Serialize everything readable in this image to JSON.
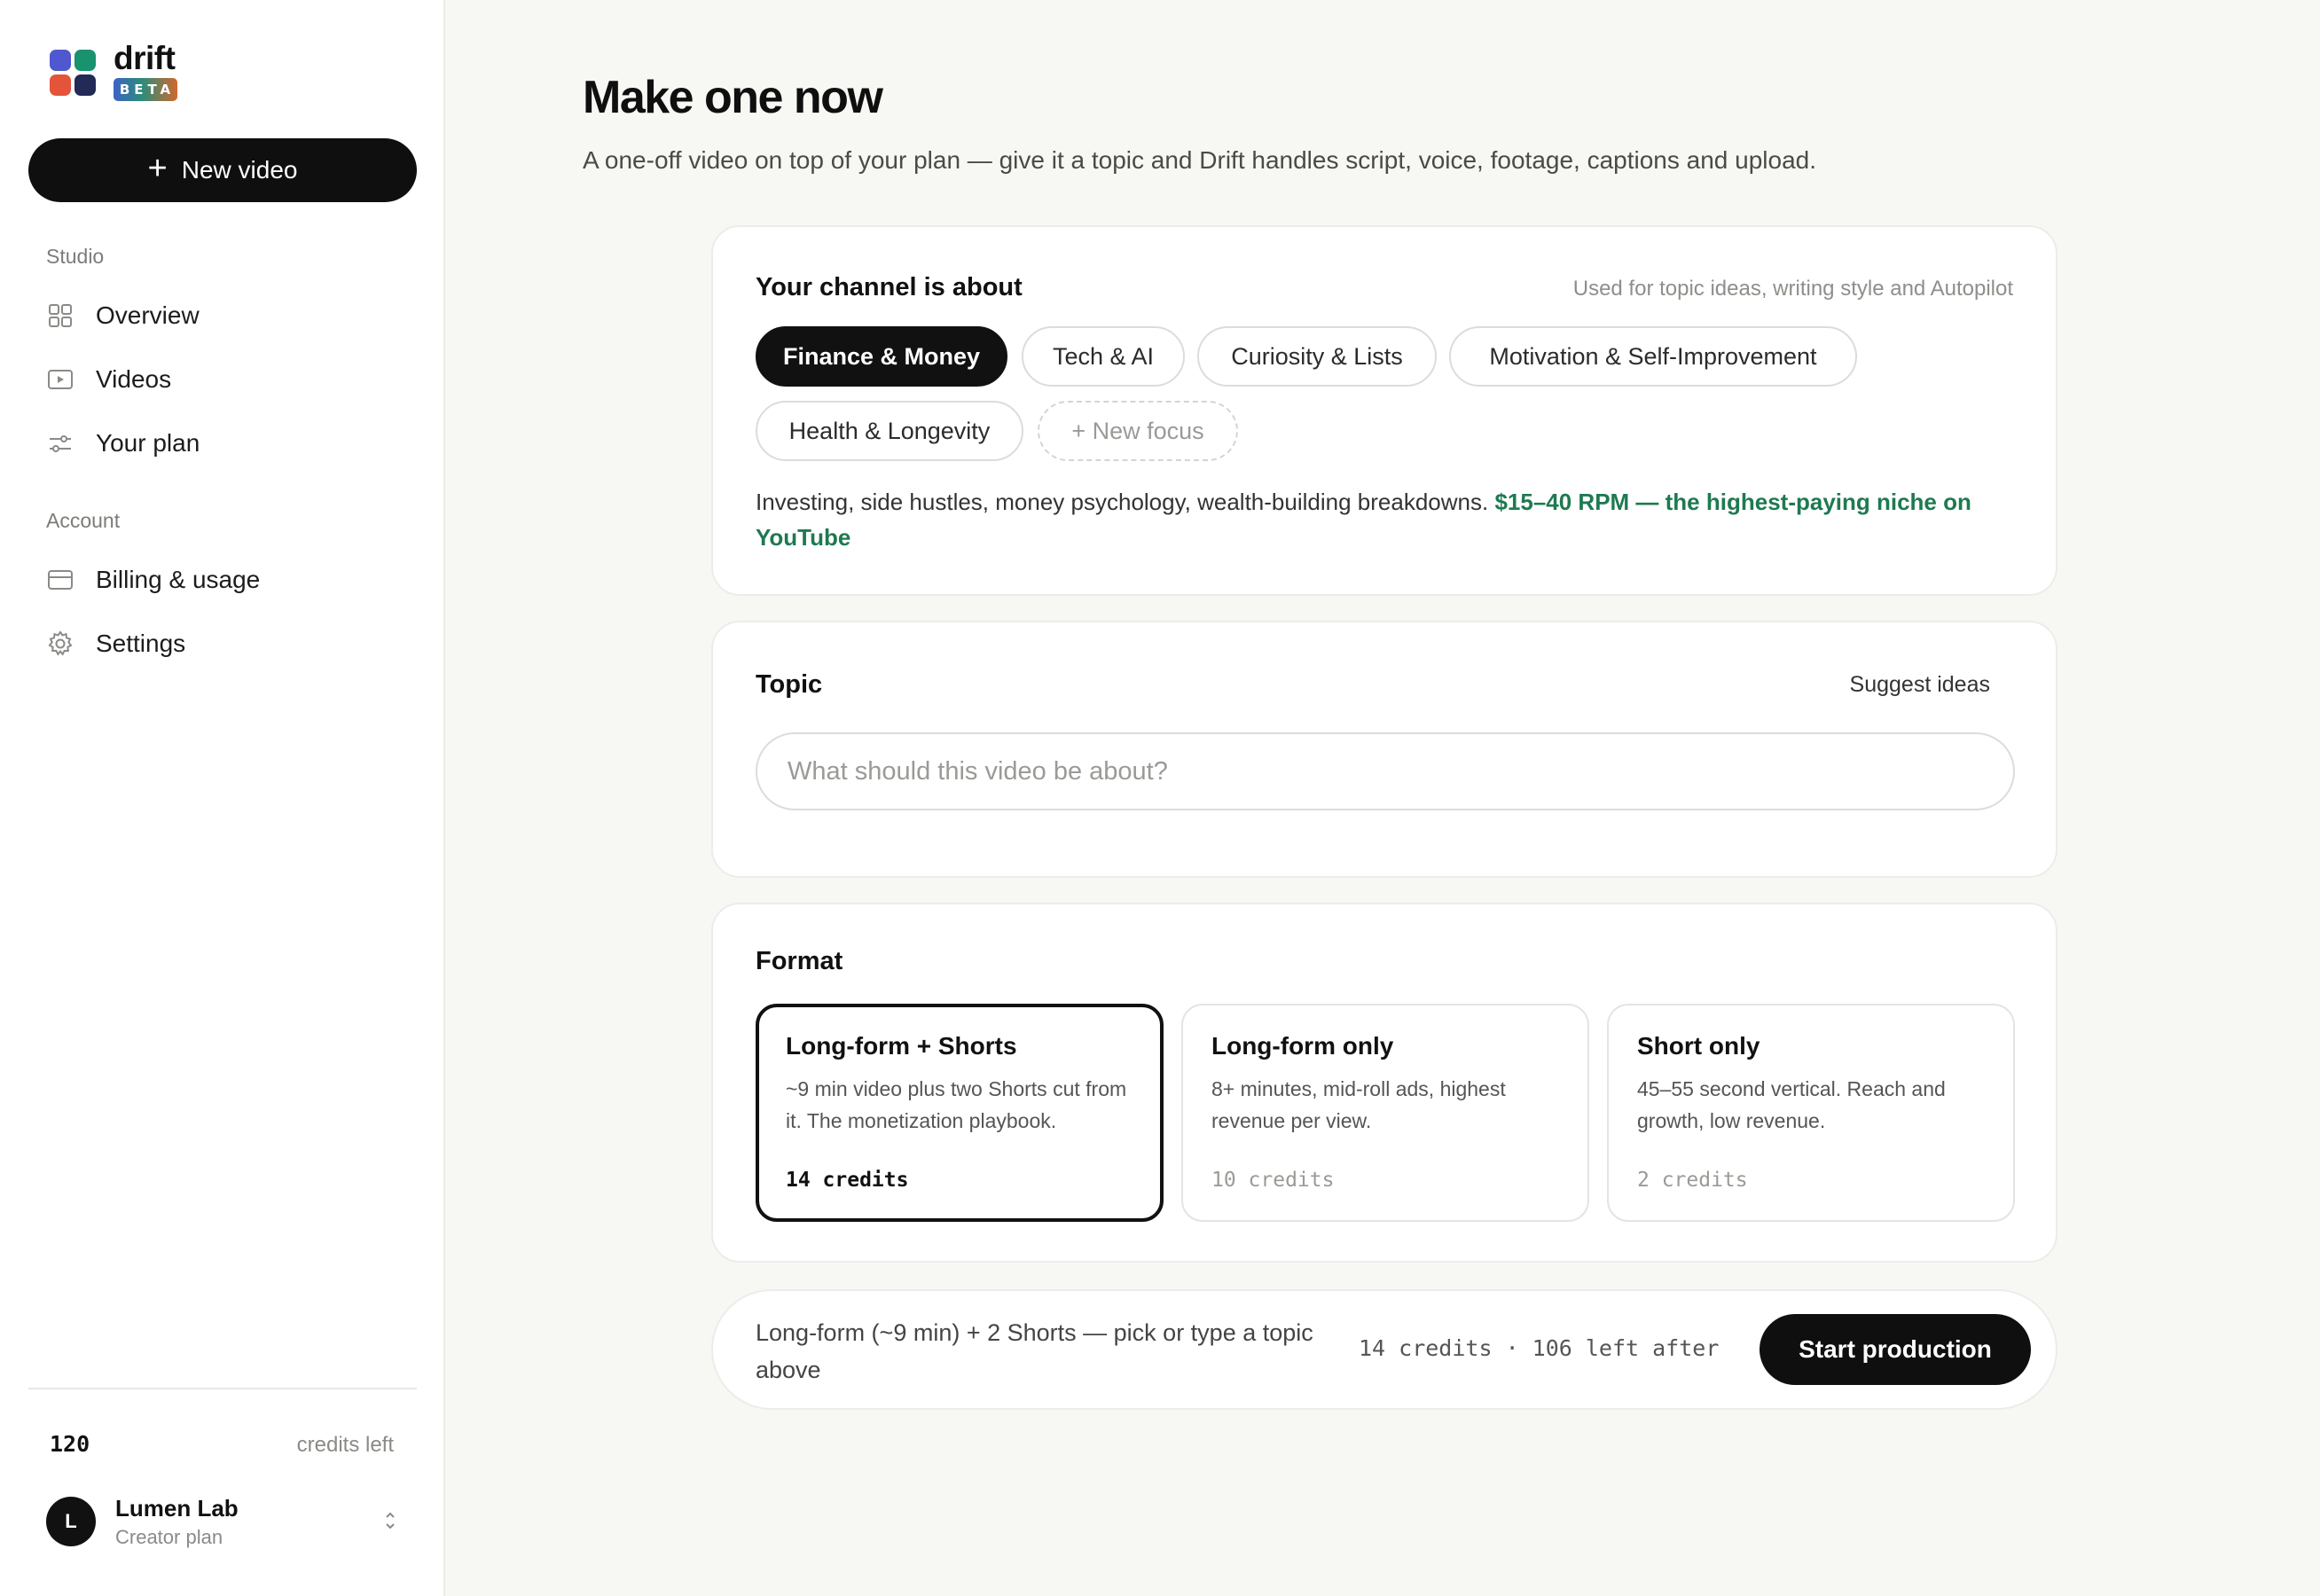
{
  "brand": {
    "name": "drift",
    "badge": "BETA",
    "logo_colors": [
      "#4f58cf",
      "#19926e",
      "#e3543a",
      "#222a55"
    ]
  },
  "sidebar": {
    "new_video_label": "New video",
    "sections": [
      {
        "title": "Studio",
        "items": [
          {
            "label": "Overview",
            "icon": "grid-icon"
          },
          {
            "label": "Videos",
            "icon": "play-icon"
          },
          {
            "label": "Your plan",
            "icon": "sliders-icon"
          }
        ]
      },
      {
        "title": "Account",
        "items": [
          {
            "label": "Billing & usage",
            "icon": "card-icon"
          },
          {
            "label": "Settings",
            "icon": "gear-icon"
          }
        ]
      }
    ],
    "credits": {
      "value": "120",
      "label": "credits left"
    },
    "account": {
      "initial": "L",
      "name": "Lumen Lab",
      "plan": "Creator plan"
    }
  },
  "main": {
    "title": "Make one now",
    "subtitle": "A one-off video on top of your plan — give it a topic and Drift handles script, voice, footage, captions and upload.",
    "channel": {
      "title": "Your channel is about",
      "hint": "Used for topic ideas, writing style and Autopilot",
      "chips": [
        {
          "label": "Finance & Money",
          "active": true
        },
        {
          "label": "Tech & AI",
          "active": false
        },
        {
          "label": "Curiosity & Lists",
          "active": false
        },
        {
          "label": "Motivation & Self-Improvement",
          "active": false
        },
        {
          "label": "Health & Longevity",
          "active": false
        }
      ],
      "new_focus_label": "+ New focus",
      "description": "Investing, side hustles, money psychology, wealth-building breakdowns.",
      "highlight": "$15–40 RPM — the highest-paying niche on YouTube",
      "highlight_color": "#1e7a50"
    },
    "topic": {
      "title": "Topic",
      "suggest_label": "Suggest ideas",
      "value": "",
      "placeholder": "What should this video be about?"
    },
    "format": {
      "title": "Format",
      "options": [
        {
          "title": "Long-form + Shorts",
          "desc": "~9 min video plus two Shorts cut from it. The monetization playbook.",
          "cost": "14 credits",
          "selected": true
        },
        {
          "title": "Long-form only",
          "desc": "8+ minutes, mid-roll ads, highest revenue per view.",
          "cost": "10 credits",
          "selected": false
        },
        {
          "title": "Short only",
          "desc": "45–55 second vertical. Reach and growth, low revenue.",
          "cost": "2 credits",
          "selected": false
        }
      ]
    },
    "footer": {
      "summary": "Long-form (~9 min) + 2 Shorts — pick or type a topic above",
      "cost": "14 credits · 106 left after",
      "start_label": "Start production"
    }
  }
}
